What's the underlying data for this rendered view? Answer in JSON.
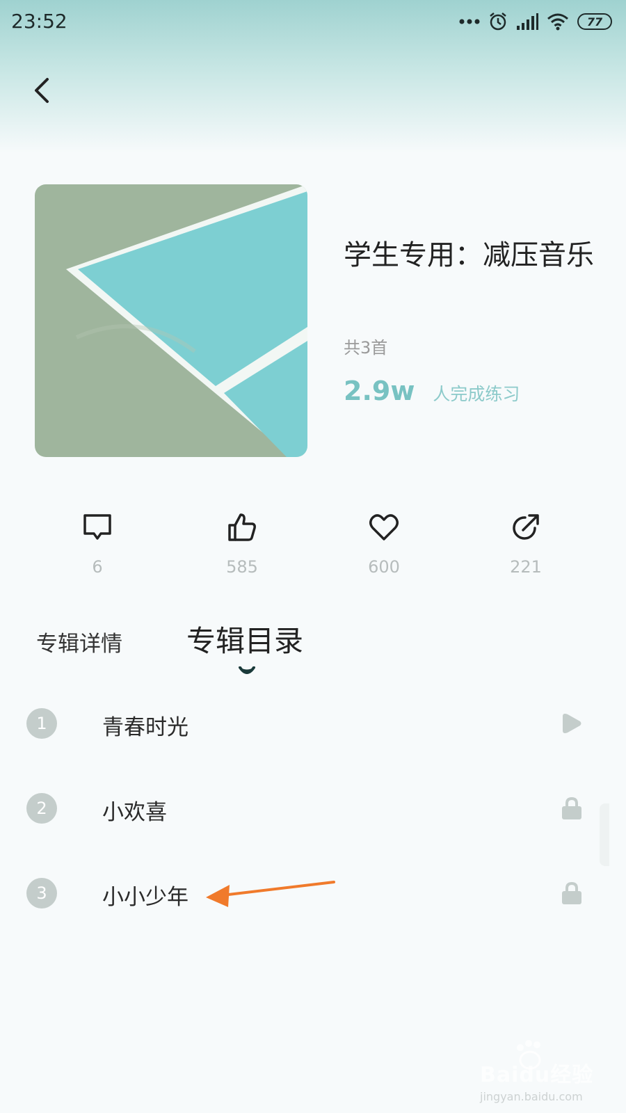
{
  "status_bar": {
    "time": "23:52",
    "battery": "77",
    "icons": [
      "more-dots-icon",
      "alarm-icon",
      "signal-icon",
      "wifi-icon",
      "battery-icon"
    ]
  },
  "header": {
    "back_icon": "chevron-left-icon"
  },
  "album": {
    "title": "学生专用：减压音乐",
    "track_count": "共3首",
    "completion_count": "2.9w",
    "completion_label": "人完成练习"
  },
  "actions": [
    {
      "icon": "comment-icon",
      "count": "6"
    },
    {
      "icon": "thumbs-up-icon",
      "count": "585"
    },
    {
      "icon": "heart-icon",
      "count": "600"
    },
    {
      "icon": "share-icon",
      "count": "221"
    }
  ],
  "tabs": {
    "details": "专辑详情",
    "list": "专辑目录",
    "active": "list"
  },
  "tracks": [
    {
      "num": "1",
      "title": "青春时光",
      "icon": "play-icon"
    },
    {
      "num": "2",
      "title": "小欢喜",
      "icon": "lock-icon"
    },
    {
      "num": "3",
      "title": "小小少年",
      "icon": "lock-icon"
    }
  ],
  "watermark": {
    "text": "Baidu经验",
    "url": "jingyan.baidu.com"
  },
  "colors": {
    "accent": "#78c2c2",
    "header_gradient": "#9fd2d0",
    "arrow": "#f07a2b"
  }
}
